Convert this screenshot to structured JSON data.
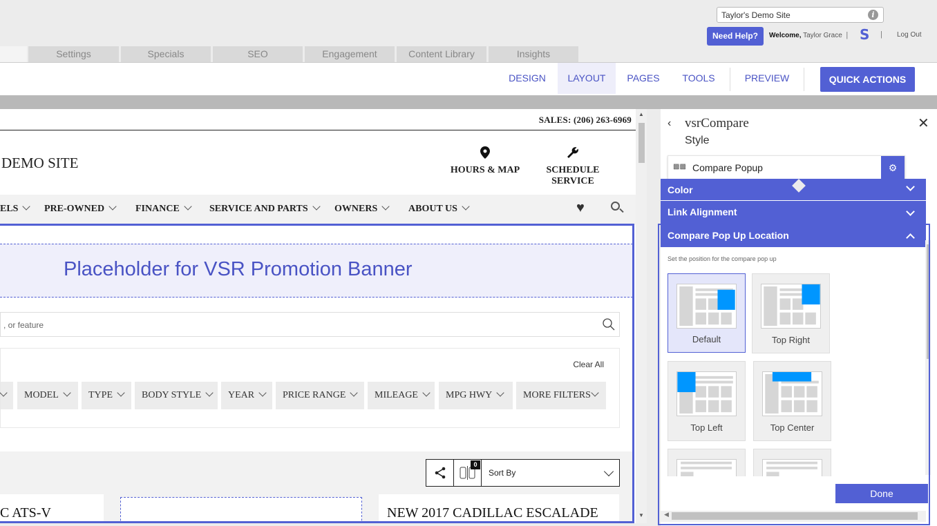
{
  "header": {
    "site_select": "Taylor's Demo Site",
    "help_button": "Need Help?",
    "welcome_label": "Welcome,",
    "user_name": "Taylor Grace",
    "sep1": "|",
    "sep2": "|",
    "logout": "Log Out"
  },
  "tabs": [
    {
      "label": ""
    },
    {
      "label": "Settings"
    },
    {
      "label": "Specials"
    },
    {
      "label": "SEO"
    },
    {
      "label": "Engagement"
    },
    {
      "label": "Content Library"
    },
    {
      "label": "Insights"
    }
  ],
  "toolbar": {
    "design": "DESIGN",
    "layout": "LAYOUT",
    "pages": "PAGES",
    "tools": "TOOLS",
    "preview": "PREVIEW",
    "quick_actions": "QUICK ACTIONS"
  },
  "site": {
    "sales": "SALES: (206) 263-6969",
    "brand": "DEMO SITE",
    "hours": "HOURS & MAP",
    "service": "SCHEDULE SERVICE",
    "nav": [
      "ELS",
      "PRE-OWNED",
      "FINANCE",
      "SERVICE AND PARTS",
      "OWNERS",
      "ABOUT US"
    ],
    "promo": "Placeholder for VSR Promotion Banner",
    "search_placeholder": ", or feature",
    "clear_all": "Clear All",
    "filters": [
      "MODEL",
      "TYPE",
      "BODY STYLE",
      "YEAR",
      "PRICE RANGE",
      "MILEAGE",
      "MPG HWY",
      "MORE FILTERS"
    ],
    "compare_count": "0",
    "sort_by": "Sort By",
    "card1": "C ATS-V",
    "card3": "NEW 2017 CADILLAC ESCALADE"
  },
  "panel": {
    "title": "vsrCompare",
    "subtitle": "Style",
    "select": "Compare Popup",
    "acc_color": "Color",
    "acc_link": "Link Alignment",
    "acc_location": "Compare Pop Up Location",
    "hint": "Set the position for the compare pop up",
    "options": [
      "Default",
      "Top Right",
      "Top Left",
      "Top Center"
    ],
    "done": "Done"
  },
  "colors": {
    "accent": "#5260d4",
    "popup_blue": "#0096ff"
  }
}
